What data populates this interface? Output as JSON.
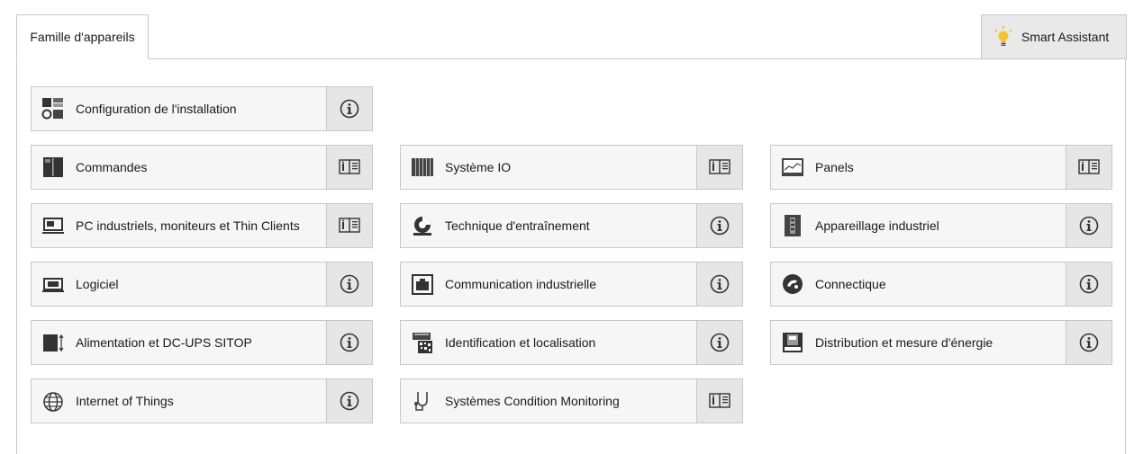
{
  "tab": {
    "label": "Famille d'appareils"
  },
  "assistant": {
    "label": "Smart Assistant",
    "icon": "lightbulb-icon"
  },
  "tiles": [
    {
      "label": "Configuration de l'installation",
      "icon": "installation-config-icon",
      "action": "info"
    },
    {
      "label": "Commandes",
      "icon": "controller-icon",
      "action": "catalog"
    },
    {
      "label": "Système IO",
      "icon": "io-system-icon",
      "action": "catalog"
    },
    {
      "label": "Panels",
      "icon": "panel-icon",
      "action": "catalog"
    },
    {
      "label": "PC industriels, moniteurs et Thin Clients",
      "icon": "industrial-pc-icon",
      "action": "catalog"
    },
    {
      "label": "Technique d'entraînement",
      "icon": "drive-icon",
      "action": "info"
    },
    {
      "label": "Appareillage industriel",
      "icon": "switchgear-icon",
      "action": "info"
    },
    {
      "label": "Logiciel",
      "icon": "software-icon",
      "action": "info"
    },
    {
      "label": "Communication industrielle",
      "icon": "communication-icon",
      "action": "info"
    },
    {
      "label": "Connectique",
      "icon": "connector-icon",
      "action": "info"
    },
    {
      "label": "Alimentation et DC-UPS SITOP",
      "icon": "power-supply-icon",
      "action": "info"
    },
    {
      "label": "Identification et localisation",
      "icon": "identification-icon",
      "action": "info"
    },
    {
      "label": "Distribution et mesure d'énergie",
      "icon": "energy-distribution-icon",
      "action": "info"
    },
    {
      "label": "Internet of Things",
      "icon": "globe-icon",
      "action": "info"
    },
    {
      "label": "Systèmes Condition Monitoring",
      "icon": "stethoscope-icon",
      "action": "catalog"
    }
  ]
}
